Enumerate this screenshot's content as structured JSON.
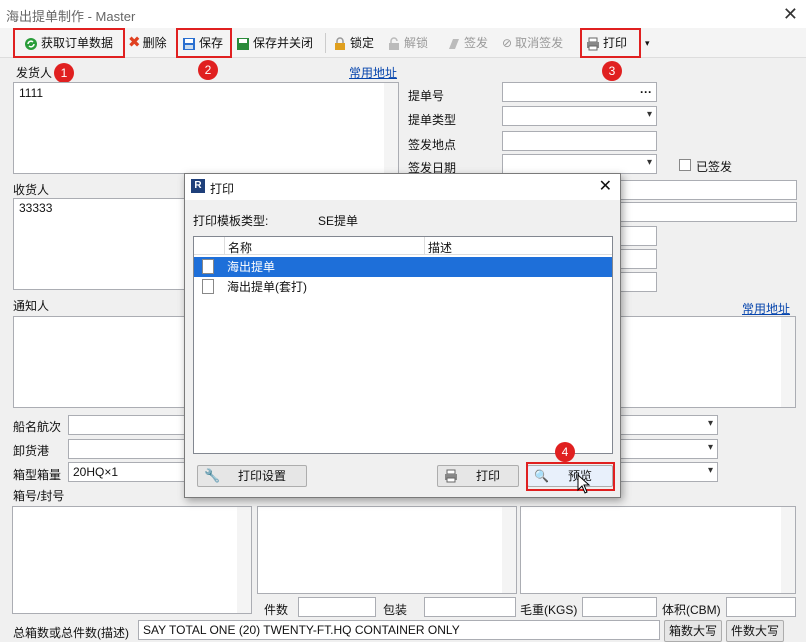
{
  "window": {
    "title": "海出提单制作 - Master",
    "close": "✕"
  },
  "toolbar": {
    "get_order": "获取订单数据",
    "delete": "删除",
    "save": "保存",
    "save_close": "保存并关闭",
    "lock": "锁定",
    "unlock": "解锁",
    "sign": "签发",
    "cancel_sign": "取消签发",
    "print": "打印"
  },
  "badges": [
    "1",
    "2",
    "3",
    "4"
  ],
  "shipper": {
    "label": "发货人",
    "link": "常用地址",
    "value": "1111"
  },
  "consignee": {
    "label": "收货人",
    "value": "33333"
  },
  "notify": {
    "label": "通知人",
    "link": "常用地址"
  },
  "bl_fields": {
    "bl_no": "提单号",
    "bl_no_btn": "···",
    "bl_type": "提单类型",
    "issue_place": "签发地点",
    "issue_date": "签发日期",
    "issued": "已签发"
  },
  "ship_fields": {
    "vessel": "船名航次",
    "pod": "卸货港",
    "container": "箱型箱量",
    "container_value": "20HQ×1",
    "marks": "箱号/封号"
  },
  "bottom": {
    "pieces": "件数",
    "package": "包装",
    "gross_weight": "毛重(KGS)",
    "volume": "体积(CBM)",
    "total_label": "总箱数或总件数(描述)",
    "total_value": "SAY TOTAL ONE (20) TWENTY-FT.HQ CONTAINER ONLY",
    "box_upper": "箱数大写",
    "piece_upper": "件数大写"
  },
  "dialog": {
    "title": "打印",
    "template_type_label": "打印模板类型:",
    "template_type_value": "SE提单",
    "col_name": "名称",
    "col_desc": "描述",
    "rows": [
      "海出提单",
      "海出提单(套打)"
    ],
    "print_settings": "打印设置",
    "print": "打印",
    "preview": "预览"
  },
  "colors": {
    "highlight": "#e02020",
    "selection": "#1e6fd9",
    "link": "#0645ad"
  }
}
